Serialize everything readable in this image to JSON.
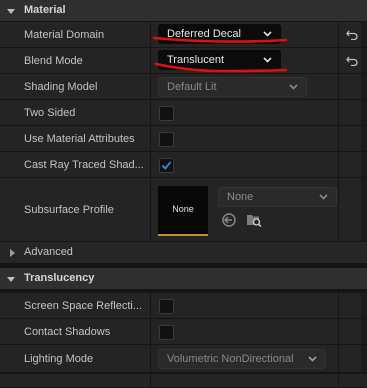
{
  "sections": {
    "material": "Material",
    "advanced": "Advanced",
    "translucency": "Translucency"
  },
  "rows": {
    "material_domain": {
      "label": "Material Domain",
      "value": "Deferred Decal"
    },
    "blend_mode": {
      "label": "Blend Mode",
      "value": "Translucent"
    },
    "shading_model": {
      "label": "Shading Model",
      "value": "Default Lit"
    },
    "two_sided": {
      "label": "Two Sided",
      "checked": false
    },
    "use_material_attributes": {
      "label": "Use Material Attributes",
      "checked": false
    },
    "cast_ray_traced_shadows": {
      "label": "Cast Ray Traced Shad...",
      "checked": true
    },
    "subsurface_profile": {
      "label": "Subsurface Profile",
      "thumbnail": "None",
      "value": "None"
    },
    "screen_space_reflections": {
      "label": "Screen Space Reflecti...",
      "checked": false
    },
    "contact_shadows": {
      "label": "Contact Shadows",
      "checked": false
    },
    "lighting_mode": {
      "label": "Lighting Mode",
      "value": "Volumetric NonDirectional"
    }
  },
  "icons": {
    "reset": "reset-to-default-icon",
    "use_selected": "use-selected-asset-icon",
    "browse": "browse-to-asset-icon",
    "check": "checkmark-icon"
  },
  "colors": {
    "accent_check": "#2f8fe8",
    "annotation_red": "#e01010",
    "thumb_underline": "#c98a3a"
  }
}
